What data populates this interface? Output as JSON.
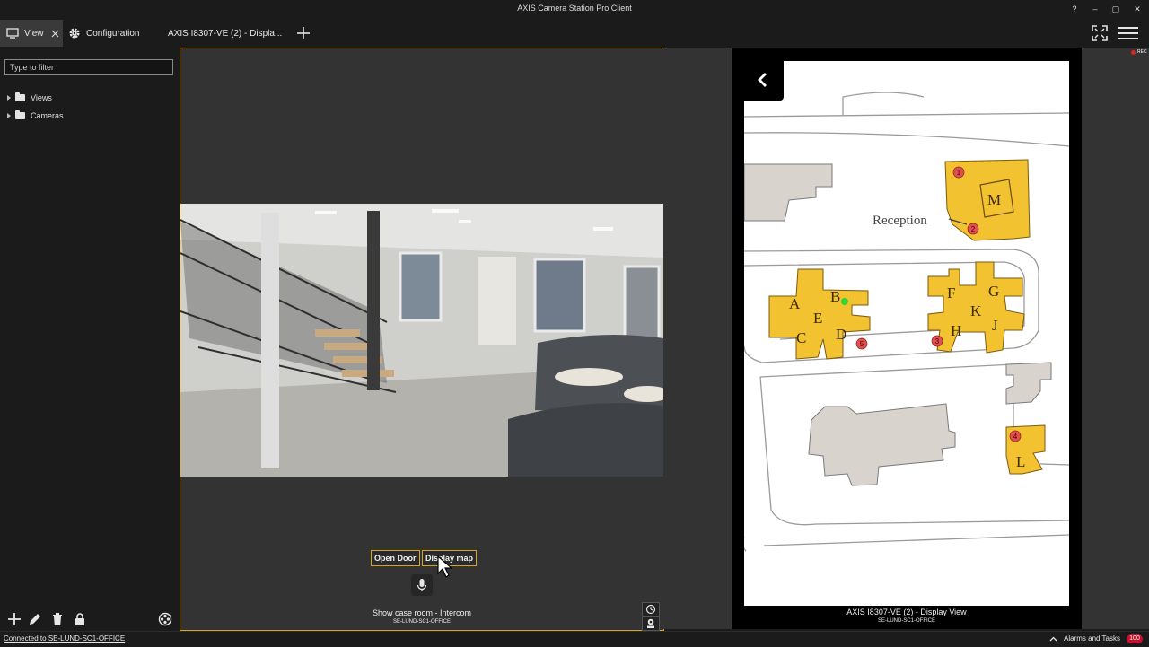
{
  "app": {
    "title": "AXIS Camera Station Pro Client"
  },
  "window_controls": {
    "help": "?",
    "minimize": "–",
    "maximize": "▢",
    "close": "✕"
  },
  "tabs": [
    {
      "label": "View"
    },
    {
      "label": "Configuration"
    },
    {
      "label": "AXIS I8307-VE (2) - Displa..."
    }
  ],
  "sidebar": {
    "filter_placeholder": "Type to filter",
    "tree": [
      {
        "label": "Views"
      },
      {
        "label": "Cameras"
      }
    ]
  },
  "video": {
    "buttons": {
      "open_door": "Open Door",
      "display_map": "Display map"
    },
    "caption": "Show case room - Intercom",
    "subcaption": "SE-LUND-SC1-OFFICE"
  },
  "display_view": {
    "caption": "AXIS I8307-VE (2) - Display View",
    "subcaption": "SE-LUND-SC1-OFFICE",
    "rec_label": "REC",
    "map": {
      "reception_label": "Reception",
      "building_labels": [
        "M",
        "A",
        "B",
        "E",
        "C",
        "D",
        "F",
        "G",
        "K",
        "H",
        "J",
        "L"
      ],
      "markers": [
        "1",
        "2",
        "3",
        "4",
        "5"
      ]
    }
  },
  "status": {
    "connection": "Connected to SE-LUND-SC1-OFFICE",
    "alarms_label": "Alarms and Tasks",
    "alarm_count": "100"
  },
  "colors": {
    "accent": "#d9a526",
    "map_building": "#f2c230",
    "map_marker": "#e05050",
    "alarm_badge": "#c8102e"
  }
}
